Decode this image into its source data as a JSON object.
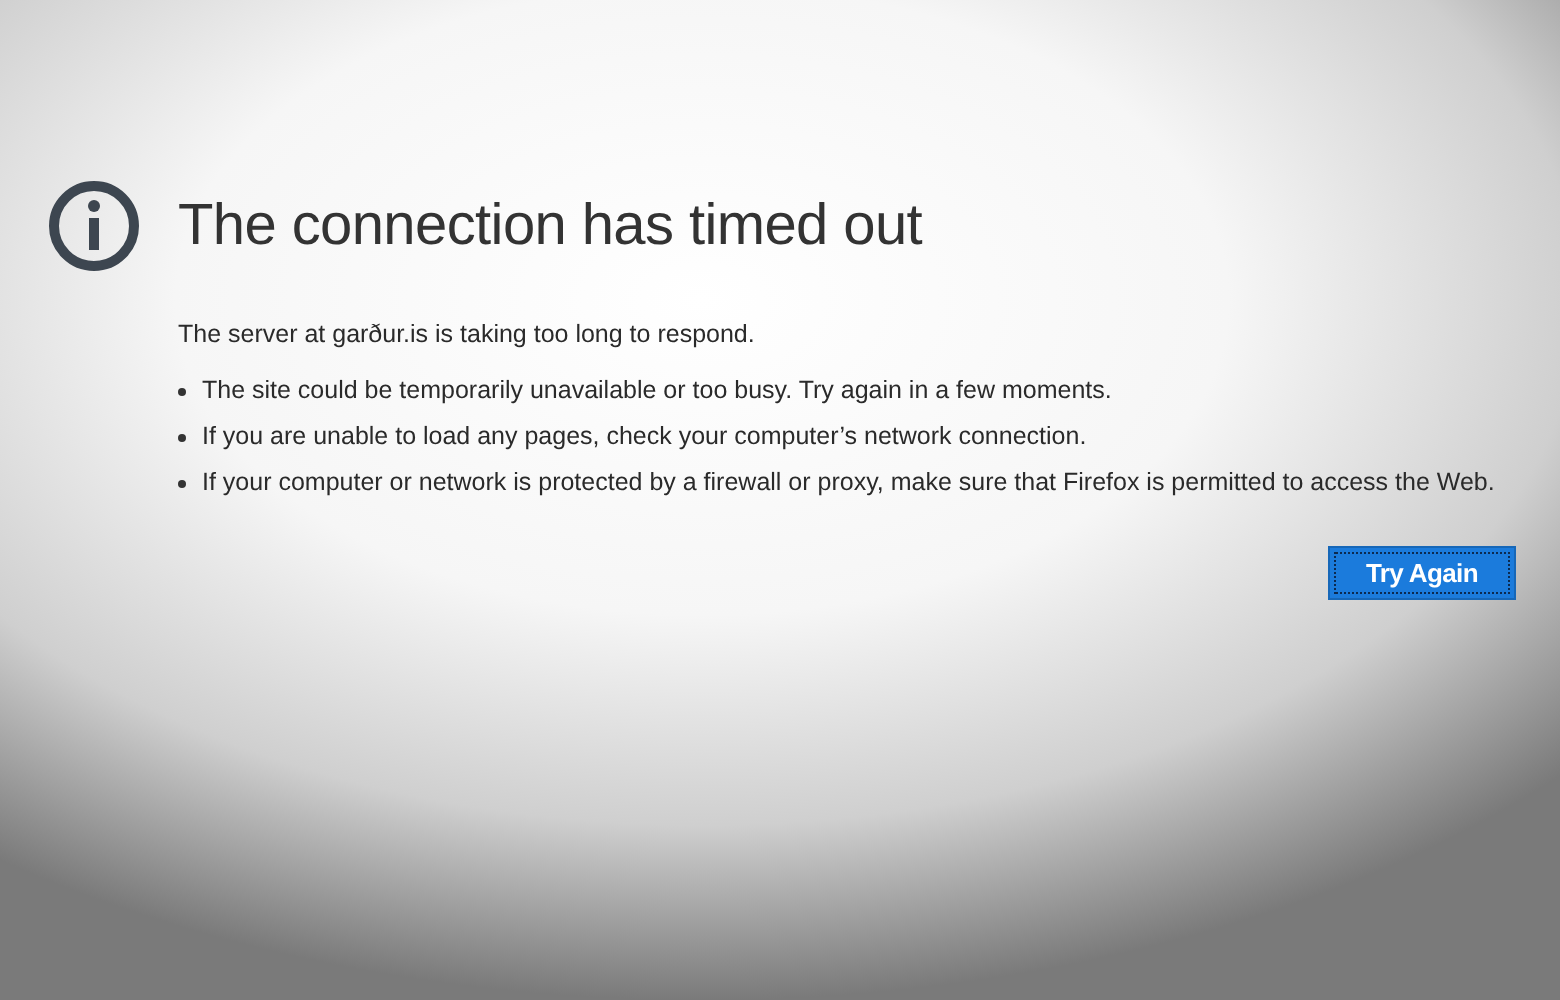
{
  "error_page": {
    "title": "The connection has timed out",
    "message": "The server at garður.is is taking too long to respond.",
    "suggestions": [
      "The site could be temporarily unavailable or too busy. Try again in a few moments.",
      "If you are unable to load any pages, check your computer’s network connection.",
      "If your computer or network is protected by a firewall or proxy, make sure that Firefox is permitted to access the Web."
    ],
    "button": {
      "label": "Try Again",
      "focused": true
    }
  }
}
